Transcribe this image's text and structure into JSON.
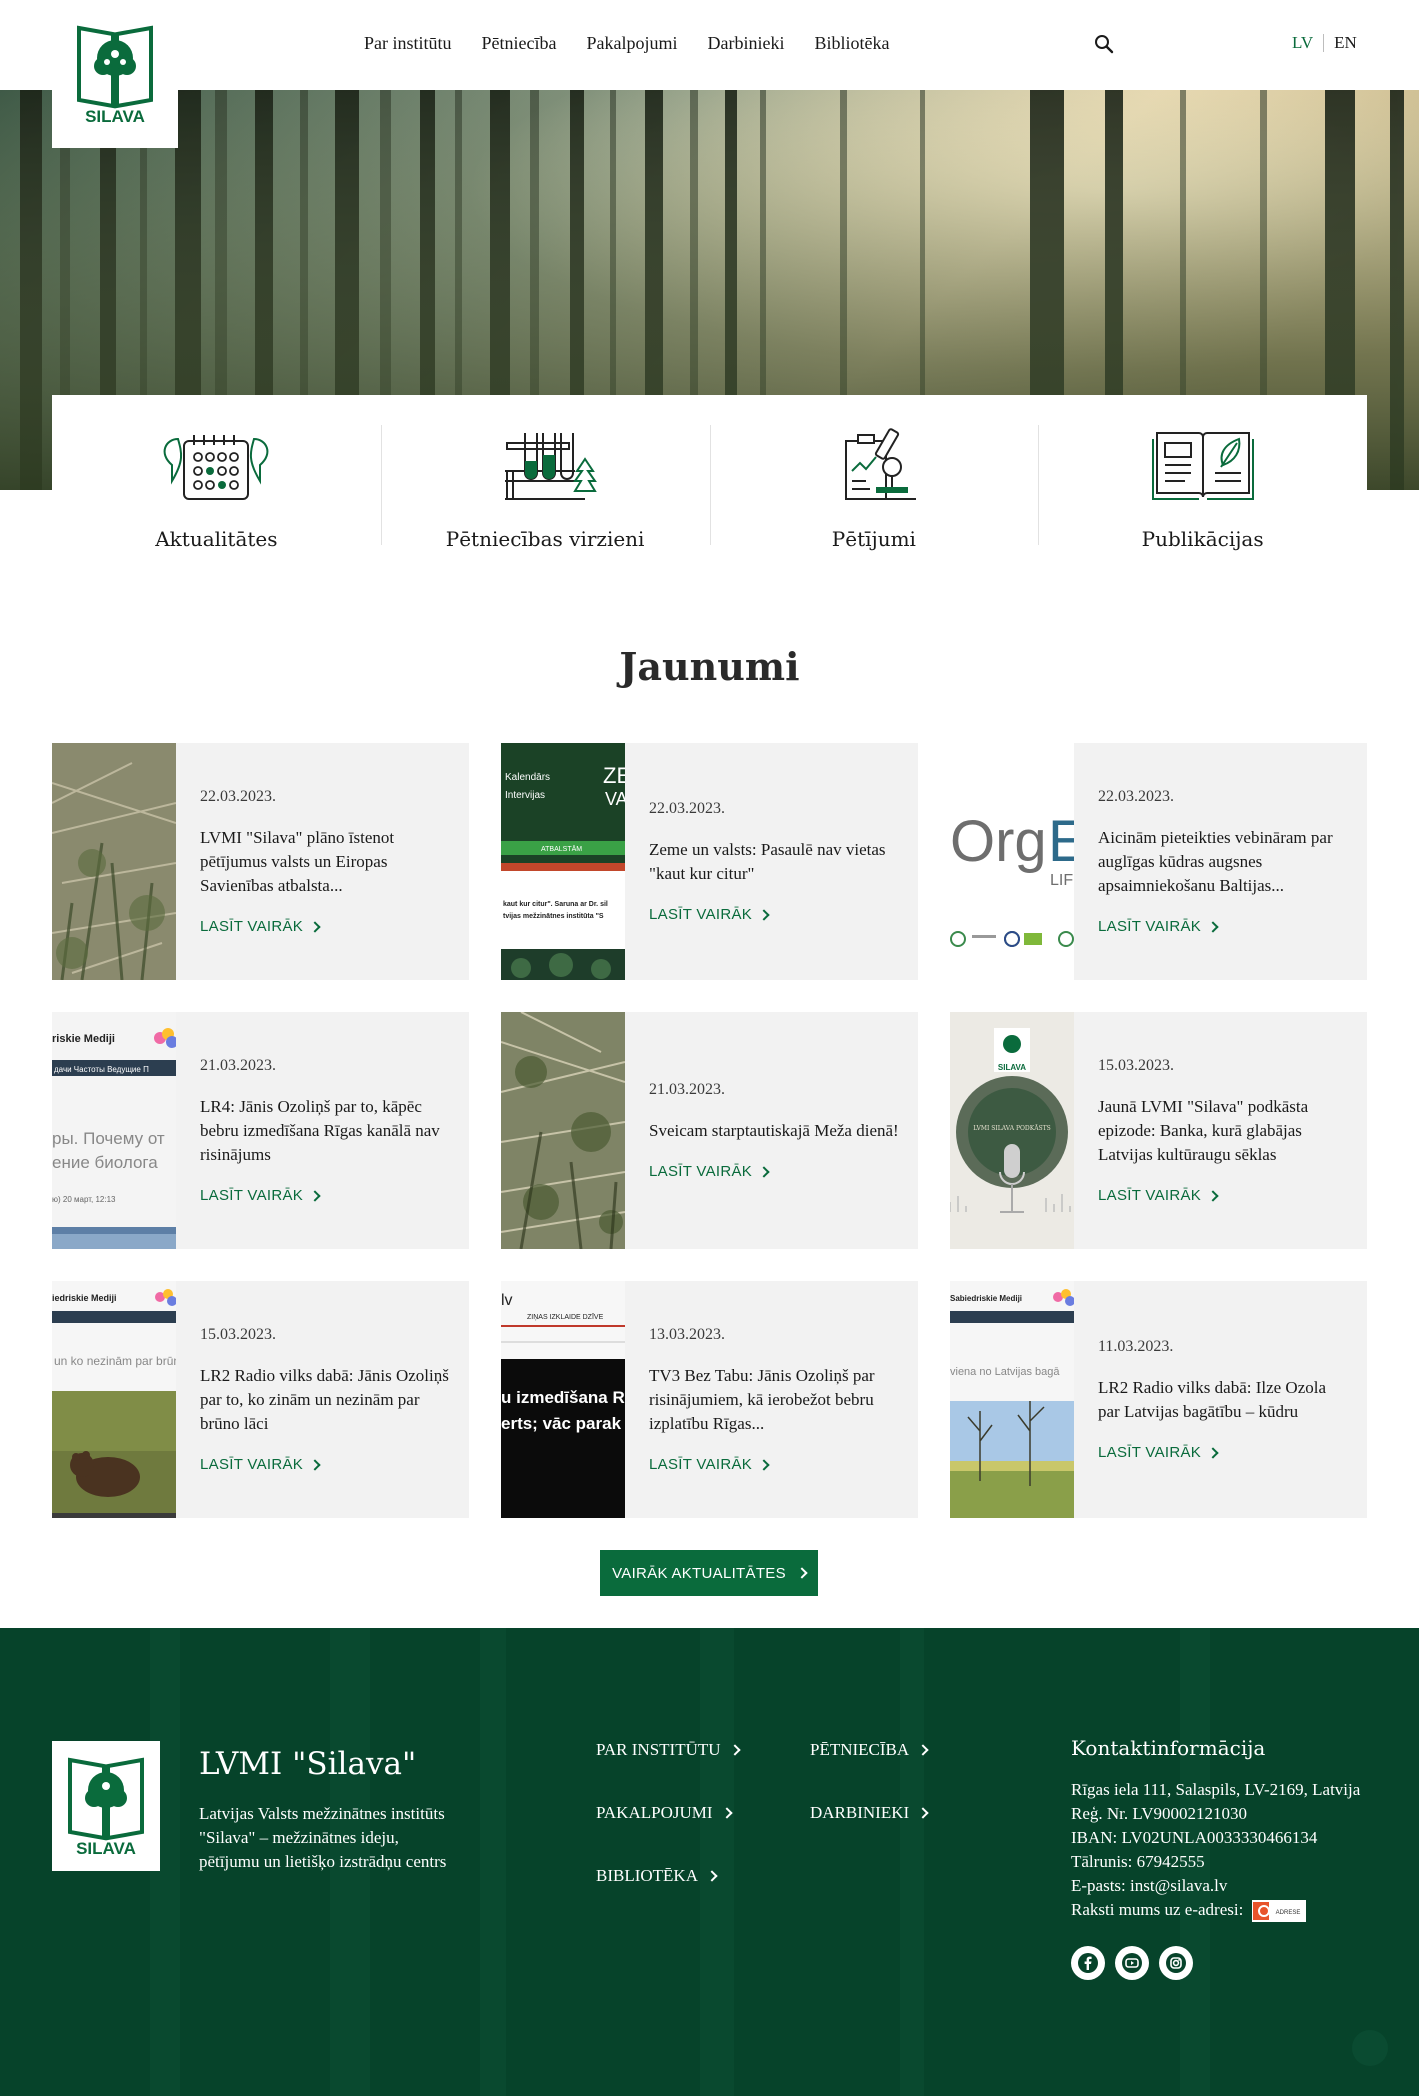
{
  "header": {
    "logo_text": "SILAVA",
    "nav": [
      "Par institūtu",
      "Pētniecība",
      "Pakalpojumi",
      "Darbinieki",
      "Bibliotēka"
    ],
    "lang_lv": "LV",
    "lang_en": "EN",
    "active_lang": "LV"
  },
  "categories": [
    {
      "label": "Aktualitātes",
      "icon": "calendar-leaves-icon"
    },
    {
      "label": "Pētniecības virzieni",
      "icon": "test-tubes-tree-icon"
    },
    {
      "label": "Pētījumi",
      "icon": "microscope-chart-icon"
    },
    {
      "label": "Publikācijas",
      "icon": "open-book-icon"
    }
  ],
  "news": {
    "title": "Jaunumi",
    "read_more": "LASĪT VAIRĀK",
    "more_button": "VAIRĀK AKTUALITĀTES",
    "items": [
      {
        "date": "22.03.2023.",
        "title": "LVMI \"Silava\" plāno īstenot pētījumus valsts un Eiropas Savienības atbalsta..."
      },
      {
        "date": "22.03.2023.",
        "title": "Zeme un valsts: Pasaulē nav vietas \"kaut kur citur\""
      },
      {
        "date": "22.03.2023.",
        "title": "Aicinām pieteikties vebināram par auglīgas kūdras augsnes apsaimniekošanu Baltijas..."
      },
      {
        "date": "21.03.2023.",
        "title": "LR4: Jānis Ozoliņš par to, kāpēc bebru izmedīšana Rīgas kanālā nav risinājums"
      },
      {
        "date": "21.03.2023.",
        "title": "Sveicam starptautiskajā Meža dienā!"
      },
      {
        "date": "15.03.2023.",
        "title": "Jaunā LVMI \"Silava\" podkāsta epizode: Banka, kurā glabājas Latvijas kultūraugu sēklas"
      },
      {
        "date": "15.03.2023.",
        "title": "LR2 Radio vilks dabā: Jānis Ozoliņš par to, ko zinām un nezinām par brūno lāci"
      },
      {
        "date": "13.03.2023.",
        "title": "TV3 Bez Tabu: Jānis Ozoliņš par risinājumiem, kā ierobežot bebru izplatību Rīgas..."
      },
      {
        "date": "11.03.2023.",
        "title": "LR2 Radio vilks dabā: Ilze Ozola par Latvijas bagātību – kūdru"
      }
    ],
    "thumb_texts": {
      "t2_a": "Kalendārs",
      "t2_b": "Intervijas",
      "t2_c": "ZE",
      "t2_d": "VA",
      "t2_e": "ATBALSTĀM",
      "t2_f": "kaut kur citur\". Saruna ar Dr. sil",
      "t2_g": "tvijas mežzinātnes institūta \"S",
      "t3_a": "Org",
      "t3_b": "E",
      "t3_c": "LIF",
      "t4_a": "riskie Mediji",
      "t4_b": "дачи   Частоты   Ведущие   П",
      "t4_c": "ры. Почему от",
      "t4_d": "ение биолога",
      "t4_e": "ю)    20 март, 12:13",
      "t6_a": "SILAVA",
      "t6_b": "LVMI SILAVA PODKĀSTS",
      "t7_a": "iedriskie Mediji",
      "t7_b": "un ko nezinām par brūn",
      "t8_a": "lv",
      "t8_b": "ZIŅAS   IZKLAIDE   DZĪVE",
      "t8_c": "u izmedīšana R",
      "t8_d": "erts; vāc parak",
      "t9_a": "Sabiedriskie Mediji",
      "t9_b": "viena no Latvijas bagā"
    }
  },
  "footer": {
    "org_name": "LVMI \"Silava\"",
    "description": "Latvijas Valsts mežzinātnes institūts \"Silava\" – mežzinātnes ideju, pētījumu un lietišķo izstrādņu centrs",
    "links": [
      "PAR INSTITŪTU",
      "PĒTNIECĪBA",
      "PAKALPOJUMI",
      "DARBINIEKI",
      "BIBLIOTĒKA"
    ],
    "contact_title": "Kontaktinformācija",
    "contacts": [
      "Rīgas iela 111, Salaspils, LV-2169, Latvija",
      "Reģ. Nr. LV90002121030",
      "IBAN: LV02UNLA0033330466134",
      "Tālrunis: 67942555",
      "E-pasts: inst@silava.lv"
    ],
    "write_us": "Raksti mums uz e-adresi:",
    "e_address_badge": "ADRESE",
    "socials": [
      "facebook-icon",
      "youtube-icon",
      "instagram-icon"
    ]
  },
  "colors": {
    "brand_green": "#0a6b3c",
    "footer_green": "#06432a",
    "card_bg": "#f2f2f2"
  }
}
